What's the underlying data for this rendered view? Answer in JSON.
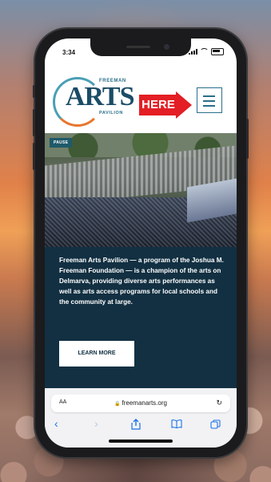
{
  "status": {
    "time": "3:34"
  },
  "header": {
    "logo": {
      "top": "FREEMAN",
      "main": "ARTS",
      "bottom": "PAVILION"
    },
    "callout": "HERE"
  },
  "hero": {
    "pause_label": "PAUSE"
  },
  "info": {
    "text": "Freeman Arts Pavilion — a program of the Joshua M. Freeman Foundation — is a champion of the arts on Delmarva, providing diverse arts performances as well as arts access programs for local schools and the community at large.",
    "button": "LEARN MORE"
  },
  "browser": {
    "aa_label": "AA",
    "url": "freemanarts.org",
    "icons": [
      "back-icon",
      "forward-icon",
      "share-icon",
      "bookmarks-icon",
      "tabs-icon",
      "reload-icon",
      "lock-icon"
    ]
  },
  "colors": {
    "brand_dark": "#123042",
    "brand_teal": "#2a6f8a",
    "callout_red": "#e31e24",
    "accent_orange": "#c75f1a",
    "ios_blue": "#1a73e8"
  }
}
